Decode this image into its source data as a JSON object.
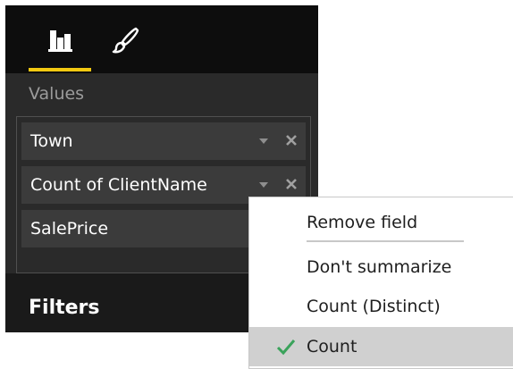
{
  "pane": {
    "tabs": [
      {
        "name": "fields",
        "icon": "bar-chart-icon",
        "active": true
      },
      {
        "name": "format",
        "icon": "paint-brush-icon",
        "active": false
      }
    ],
    "values_heading": "Values",
    "fields": [
      {
        "label": "Town",
        "has_dropdown": true,
        "has_remove": true
      },
      {
        "label": "Count of ClientName",
        "has_dropdown": true,
        "has_remove": true
      },
      {
        "label": "SalePrice"
      }
    ],
    "filters_heading": "Filters"
  },
  "context_menu": {
    "items": [
      {
        "label": "Remove field",
        "checked": false
      },
      {
        "label": "Don't summarize",
        "checked": false
      },
      {
        "label": "Count (Distinct)",
        "checked": false
      },
      {
        "label": "Count",
        "checked": true
      }
    ]
  },
  "colors": {
    "accent_underline": "#f2c811",
    "check_green": "#3aa35b",
    "pane_dark": "#2a2a2a",
    "field_bg": "#3b3b3b",
    "highlight": "#d0d0d0"
  }
}
